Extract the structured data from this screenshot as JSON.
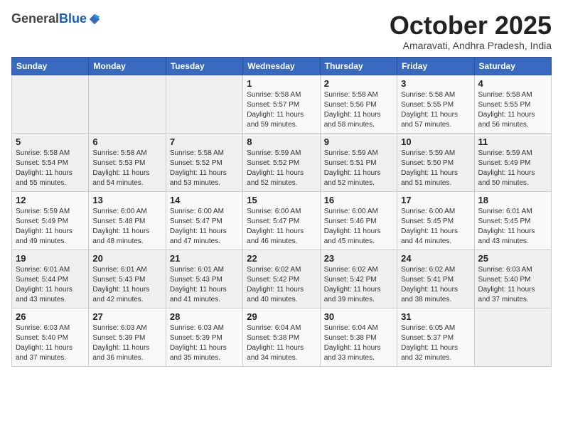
{
  "header": {
    "logo_general": "General",
    "logo_blue": "Blue",
    "month_title": "October 2025",
    "subtitle": "Amaravati, Andhra Pradesh, India"
  },
  "days_of_week": [
    "Sunday",
    "Monday",
    "Tuesday",
    "Wednesday",
    "Thursday",
    "Friday",
    "Saturday"
  ],
  "weeks": [
    [
      {
        "day": "",
        "info": ""
      },
      {
        "day": "",
        "info": ""
      },
      {
        "day": "",
        "info": ""
      },
      {
        "day": "1",
        "info": "Sunrise: 5:58 AM\nSunset: 5:57 PM\nDaylight: 11 hours\nand 59 minutes."
      },
      {
        "day": "2",
        "info": "Sunrise: 5:58 AM\nSunset: 5:56 PM\nDaylight: 11 hours\nand 58 minutes."
      },
      {
        "day": "3",
        "info": "Sunrise: 5:58 AM\nSunset: 5:55 PM\nDaylight: 11 hours\nand 57 minutes."
      },
      {
        "day": "4",
        "info": "Sunrise: 5:58 AM\nSunset: 5:55 PM\nDaylight: 11 hours\nand 56 minutes."
      }
    ],
    [
      {
        "day": "5",
        "info": "Sunrise: 5:58 AM\nSunset: 5:54 PM\nDaylight: 11 hours\nand 55 minutes."
      },
      {
        "day": "6",
        "info": "Sunrise: 5:58 AM\nSunset: 5:53 PM\nDaylight: 11 hours\nand 54 minutes."
      },
      {
        "day": "7",
        "info": "Sunrise: 5:58 AM\nSunset: 5:52 PM\nDaylight: 11 hours\nand 53 minutes."
      },
      {
        "day": "8",
        "info": "Sunrise: 5:59 AM\nSunset: 5:52 PM\nDaylight: 11 hours\nand 52 minutes."
      },
      {
        "day": "9",
        "info": "Sunrise: 5:59 AM\nSunset: 5:51 PM\nDaylight: 11 hours\nand 52 minutes."
      },
      {
        "day": "10",
        "info": "Sunrise: 5:59 AM\nSunset: 5:50 PM\nDaylight: 11 hours\nand 51 minutes."
      },
      {
        "day": "11",
        "info": "Sunrise: 5:59 AM\nSunset: 5:49 PM\nDaylight: 11 hours\nand 50 minutes."
      }
    ],
    [
      {
        "day": "12",
        "info": "Sunrise: 5:59 AM\nSunset: 5:49 PM\nDaylight: 11 hours\nand 49 minutes."
      },
      {
        "day": "13",
        "info": "Sunrise: 6:00 AM\nSunset: 5:48 PM\nDaylight: 11 hours\nand 48 minutes."
      },
      {
        "day": "14",
        "info": "Sunrise: 6:00 AM\nSunset: 5:47 PM\nDaylight: 11 hours\nand 47 minutes."
      },
      {
        "day": "15",
        "info": "Sunrise: 6:00 AM\nSunset: 5:47 PM\nDaylight: 11 hours\nand 46 minutes."
      },
      {
        "day": "16",
        "info": "Sunrise: 6:00 AM\nSunset: 5:46 PM\nDaylight: 11 hours\nand 45 minutes."
      },
      {
        "day": "17",
        "info": "Sunrise: 6:00 AM\nSunset: 5:45 PM\nDaylight: 11 hours\nand 44 minutes."
      },
      {
        "day": "18",
        "info": "Sunrise: 6:01 AM\nSunset: 5:45 PM\nDaylight: 11 hours\nand 43 minutes."
      }
    ],
    [
      {
        "day": "19",
        "info": "Sunrise: 6:01 AM\nSunset: 5:44 PM\nDaylight: 11 hours\nand 43 minutes."
      },
      {
        "day": "20",
        "info": "Sunrise: 6:01 AM\nSunset: 5:43 PM\nDaylight: 11 hours\nand 42 minutes."
      },
      {
        "day": "21",
        "info": "Sunrise: 6:01 AM\nSunset: 5:43 PM\nDaylight: 11 hours\nand 41 minutes."
      },
      {
        "day": "22",
        "info": "Sunrise: 6:02 AM\nSunset: 5:42 PM\nDaylight: 11 hours\nand 40 minutes."
      },
      {
        "day": "23",
        "info": "Sunrise: 6:02 AM\nSunset: 5:42 PM\nDaylight: 11 hours\nand 39 minutes."
      },
      {
        "day": "24",
        "info": "Sunrise: 6:02 AM\nSunset: 5:41 PM\nDaylight: 11 hours\nand 38 minutes."
      },
      {
        "day": "25",
        "info": "Sunrise: 6:03 AM\nSunset: 5:40 PM\nDaylight: 11 hours\nand 37 minutes."
      }
    ],
    [
      {
        "day": "26",
        "info": "Sunrise: 6:03 AM\nSunset: 5:40 PM\nDaylight: 11 hours\nand 37 minutes."
      },
      {
        "day": "27",
        "info": "Sunrise: 6:03 AM\nSunset: 5:39 PM\nDaylight: 11 hours\nand 36 minutes."
      },
      {
        "day": "28",
        "info": "Sunrise: 6:03 AM\nSunset: 5:39 PM\nDaylight: 11 hours\nand 35 minutes."
      },
      {
        "day": "29",
        "info": "Sunrise: 6:04 AM\nSunset: 5:38 PM\nDaylight: 11 hours\nand 34 minutes."
      },
      {
        "day": "30",
        "info": "Sunrise: 6:04 AM\nSunset: 5:38 PM\nDaylight: 11 hours\nand 33 minutes."
      },
      {
        "day": "31",
        "info": "Sunrise: 6:05 AM\nSunset: 5:37 PM\nDaylight: 11 hours\nand 32 minutes."
      },
      {
        "day": "",
        "info": ""
      }
    ]
  ]
}
